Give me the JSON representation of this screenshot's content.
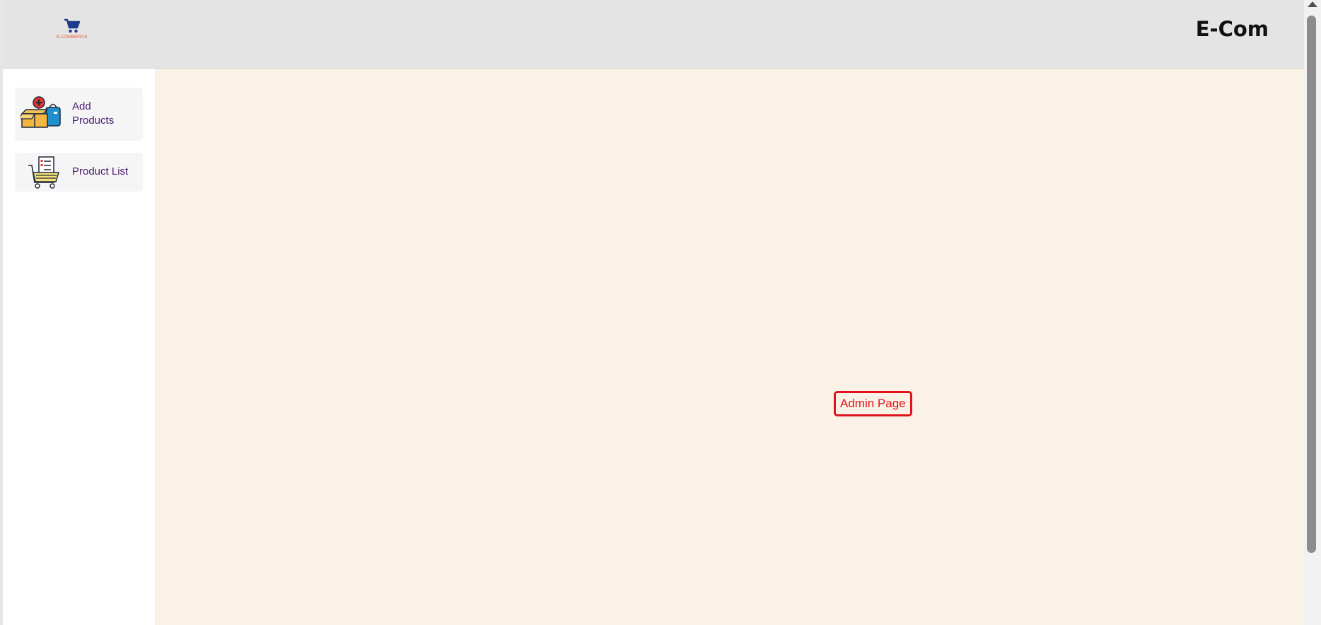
{
  "header": {
    "logo_text": "E-COMMERCE",
    "brand_title": "E-Com"
  },
  "sidebar": {
    "items": [
      {
        "label": "Add Products",
        "icon": "add-product-box-icon"
      },
      {
        "label": "Product List",
        "icon": "cart-list-icon"
      }
    ]
  },
  "main": {
    "badge": "Admin Page"
  },
  "colors": {
    "header_bg": "#e4e4e4",
    "main_bg": "#faf2e6",
    "badge_accent": "#e3111b",
    "sidebar_text": "#4a1a6e",
    "logo_cart": "#1e3a8a",
    "logo_text": "#e8582b"
  }
}
